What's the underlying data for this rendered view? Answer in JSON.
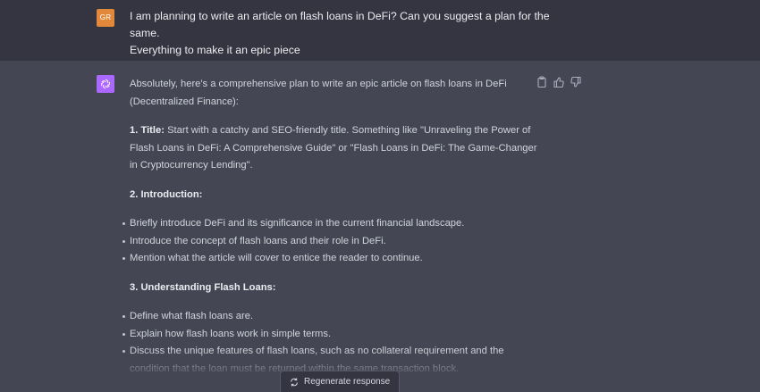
{
  "user": {
    "avatar_initials": "GR",
    "message_line1": "I am planning to write an article on flash loans in DeFi? Can you suggest a plan for the same.",
    "message_line2": "Everything to make it an epic piece"
  },
  "assistant": {
    "intro": "Absolutely, here's a comprehensive plan to write an epic article on flash loans in DeFi (Decentralized Finance):",
    "sections": [
      {
        "heading": "1. Title:",
        "text": " Start with a catchy and SEO-friendly title. Something like \"Unraveling the Power of Flash Loans in DeFi: A Comprehensive Guide\" or \"Flash Loans in DeFi: The Game-Changer in Cryptocurrency Lending\"."
      },
      {
        "heading": "2. Introduction:",
        "bullets": [
          "Briefly introduce DeFi and its significance in the current financial landscape.",
          "Introduce the concept of flash loans and their role in DeFi.",
          "Mention what the article will cover to entice the reader to continue."
        ]
      },
      {
        "heading": "3. Understanding Flash Loans:",
        "bullets": [
          "Define what flash loans are.",
          "Explain how flash loans work in simple terms.",
          "Discuss the unique features of flash loans, such as no collateral requirement and the condition that the loan must be returned within the same transaction block."
        ]
      }
    ]
  },
  "icons": {
    "copy": "clipboard-icon",
    "like": "thumbs-up-icon",
    "dislike": "thumbs-down-icon",
    "regenerate": "refresh-icon"
  },
  "controls": {
    "regenerate_label": "Regenerate response"
  },
  "colors": {
    "user_row_bg": "#343541",
    "assistant_row_bg": "#444654",
    "user_avatar": "#e1883b",
    "assistant_avatar": "#ab68ff"
  }
}
